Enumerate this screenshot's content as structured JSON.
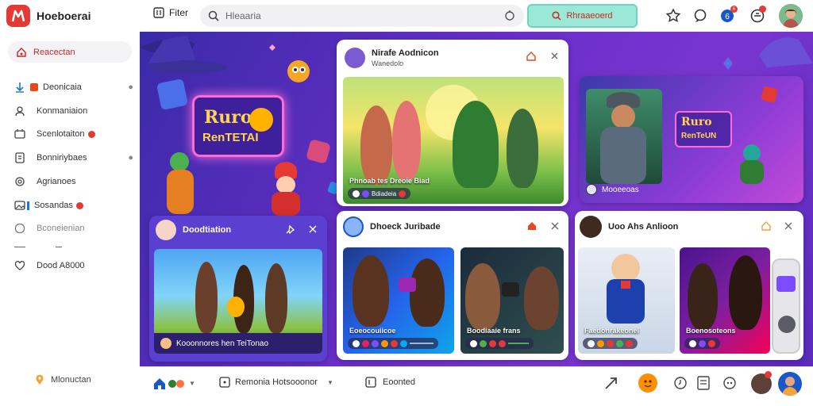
{
  "app": {
    "title": "Hoeboerai"
  },
  "topbar": {
    "filter_label": "Fiter",
    "search_placeholder": "Hleaaria",
    "cta_label": "Rhraaeoerd",
    "notification_count": "6"
  },
  "sidebar": {
    "active_label": "Reacectan",
    "items": [
      {
        "label": "Deonicaia"
      },
      {
        "label": "Konmaniaion"
      },
      {
        "label": "Scenlotaiton"
      },
      {
        "label": "Bonniriybaes"
      },
      {
        "label": "Agrianoes"
      },
      {
        "label": "Sosandas"
      },
      {
        "label": "Bconeienian"
      },
      {
        "label": "Dood A8000"
      }
    ],
    "bottom_label": "Mlonuctan"
  },
  "hero_left": {
    "logo_line1": "Ruro",
    "logo_line2": "RenTETAI"
  },
  "card_left": {
    "name": "Doodtiation",
    "caption": "Kooonnores hen TeiTonao"
  },
  "card_center_top": {
    "name": "Nirafe Aodnicon",
    "sub": "Wanedolo",
    "caption": "Phnoab tes Dreoie Biad",
    "tag": "Bdiadeia"
  },
  "card_right_top": {
    "caption": "Mooeeoas",
    "logo_line1": "Ruro",
    "logo_line2": "RenTeUN"
  },
  "card_center_bottom": {
    "name": "Dhoeck Juribade",
    "video1": {
      "caption": "Eoeocouiicoe"
    },
    "video2": {
      "caption": "Boodiaaie frans"
    }
  },
  "card_right_bottom": {
    "name": "Uoo Ahs Anlioon",
    "video1": {
      "caption": "Faedonrakeonel"
    },
    "video2": {
      "caption": "Boenosoteons"
    }
  },
  "bottombar": {
    "playlist_label": "Remonia Hotsooonor",
    "comment_label": "Eoonted"
  },
  "colors": {
    "brand": "#e53935",
    "cta_bg": "#9be8d6",
    "main_bg": "#6a2fc9"
  }
}
